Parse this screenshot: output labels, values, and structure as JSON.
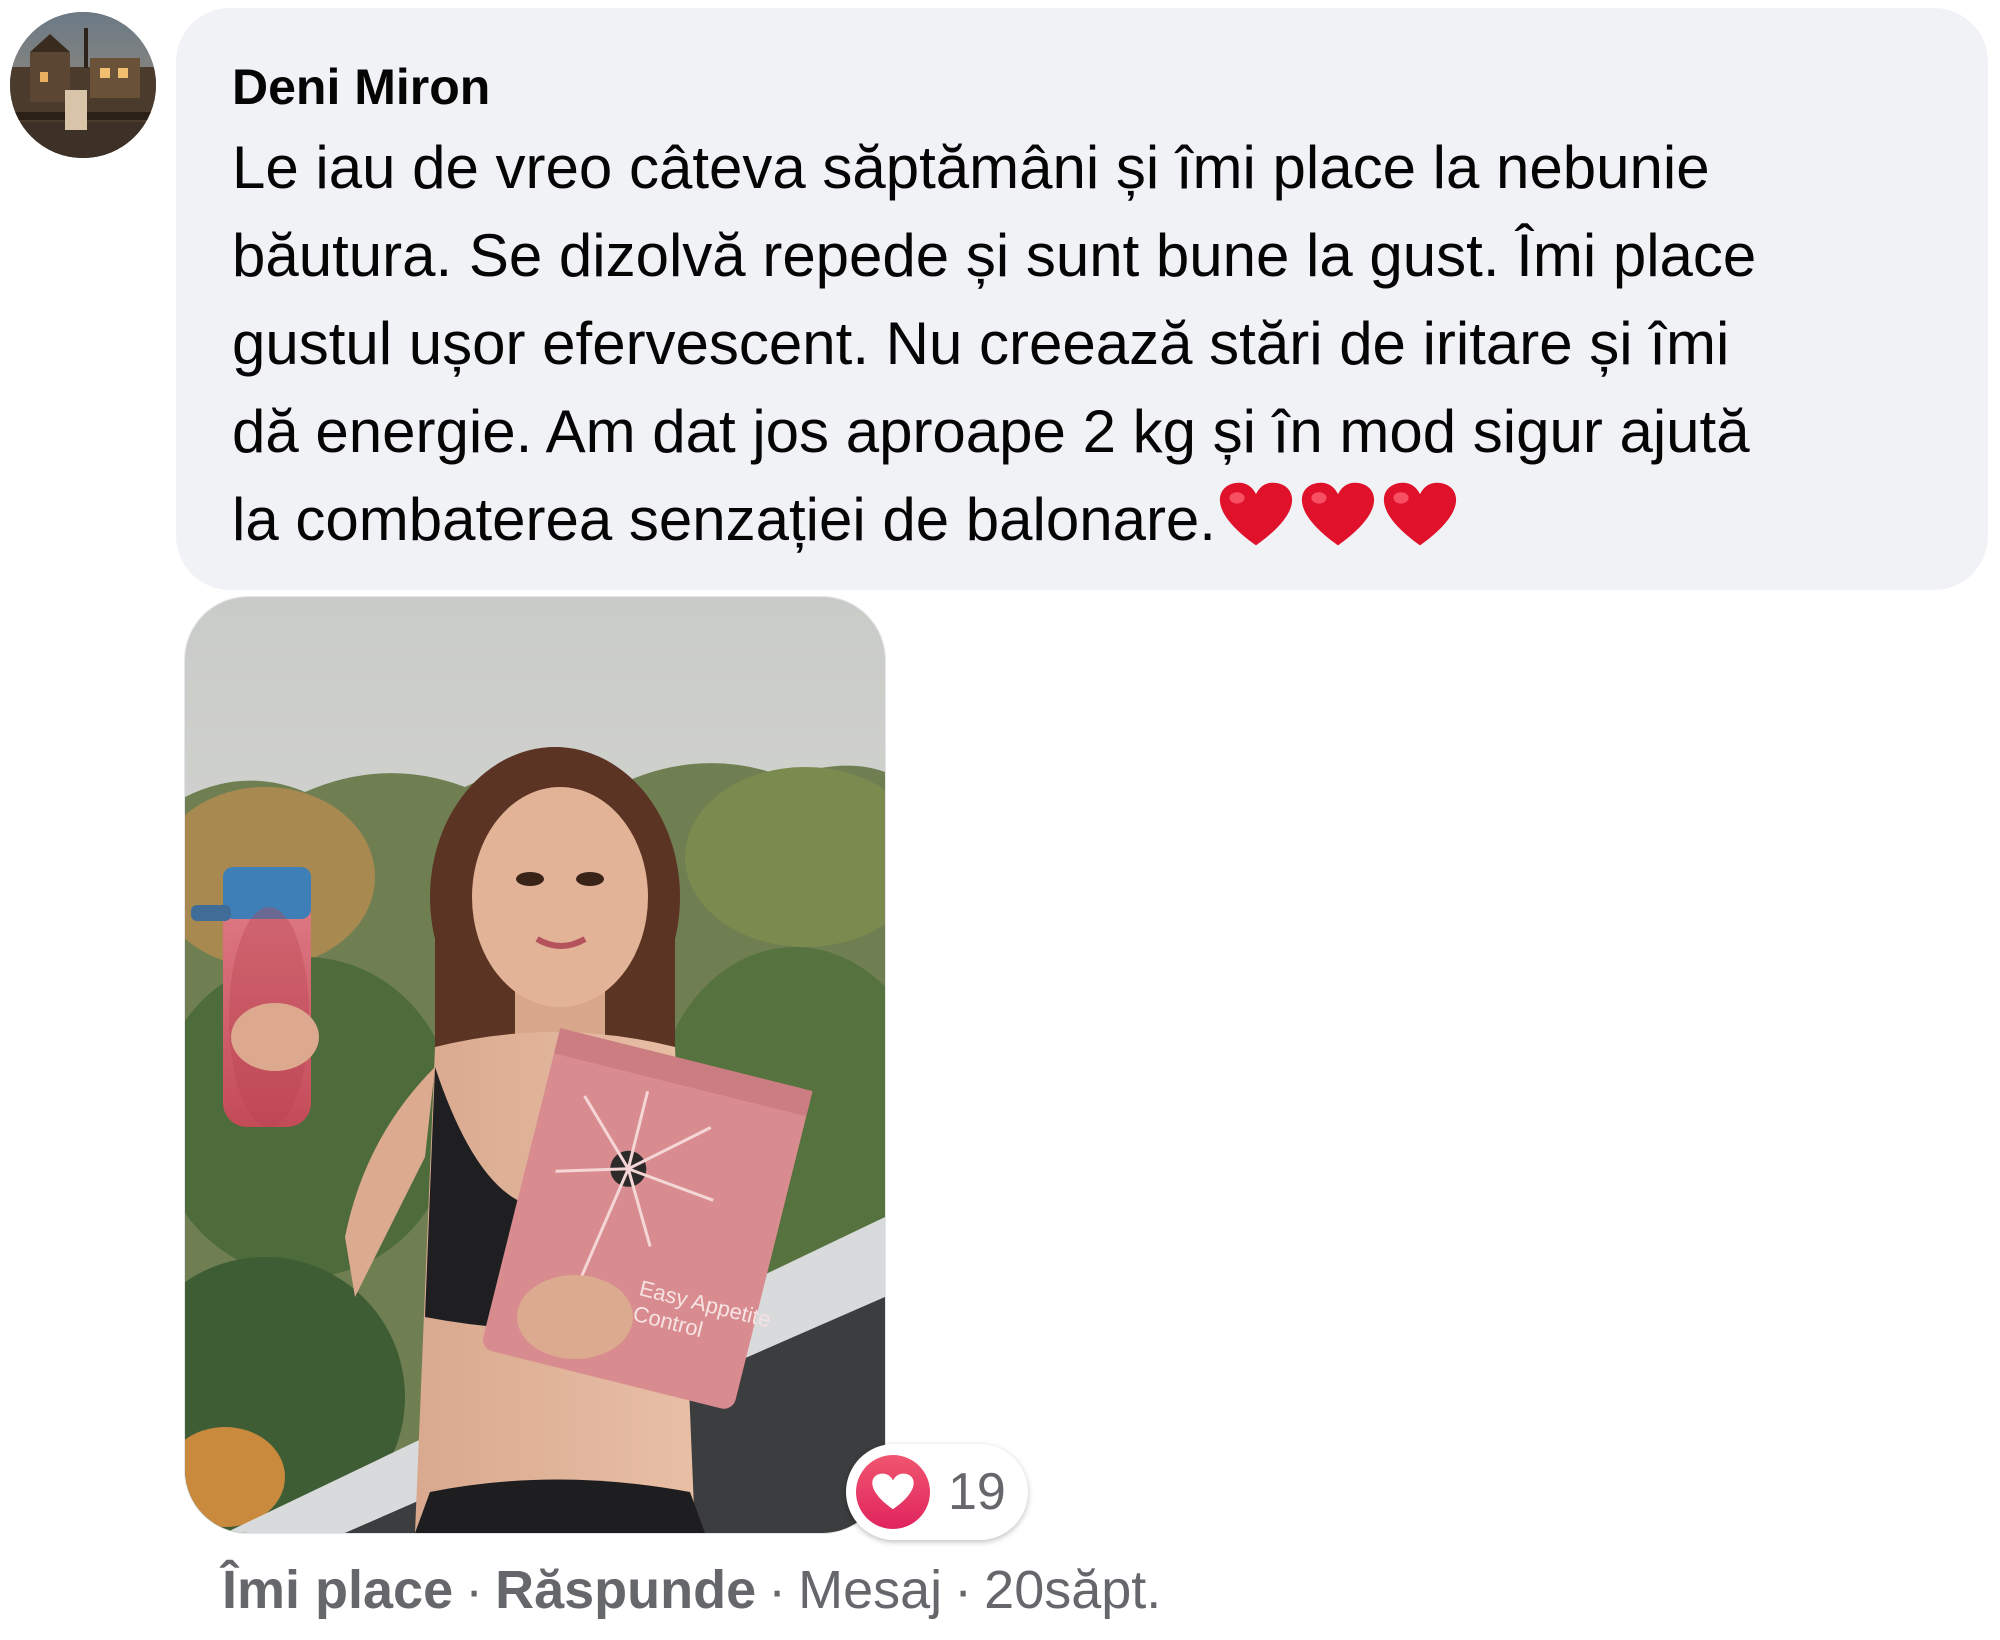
{
  "comment": {
    "author": "Deni Miron",
    "text_lines": [
      "Le iau de vreo câteva săptămâni și îmi place la nebunie",
      "băutura. Se dizolvă repede și sunt bune la gust. Îmi place",
      "gustul ușor efervescent. Nu creează stări de iritare și îmi",
      "dă energie. Am dat jos aproape 2 kg și în mod sigur ajută",
      "la combaterea senzației de balonare."
    ],
    "emoji": "heart-emoji x3",
    "heart_color": "#e0112b"
  },
  "attachment": {
    "photo": "woman-holding-shaker-and-pink-pouch",
    "pouch_text": "Easy Appetite Control"
  },
  "reactions": {
    "type": "love",
    "count": "19",
    "color": "#e0245e"
  },
  "actions": {
    "like": "Îmi place",
    "reply": "Răspunde",
    "message": "Mesaj",
    "separator": "·",
    "time": "20săpt."
  }
}
